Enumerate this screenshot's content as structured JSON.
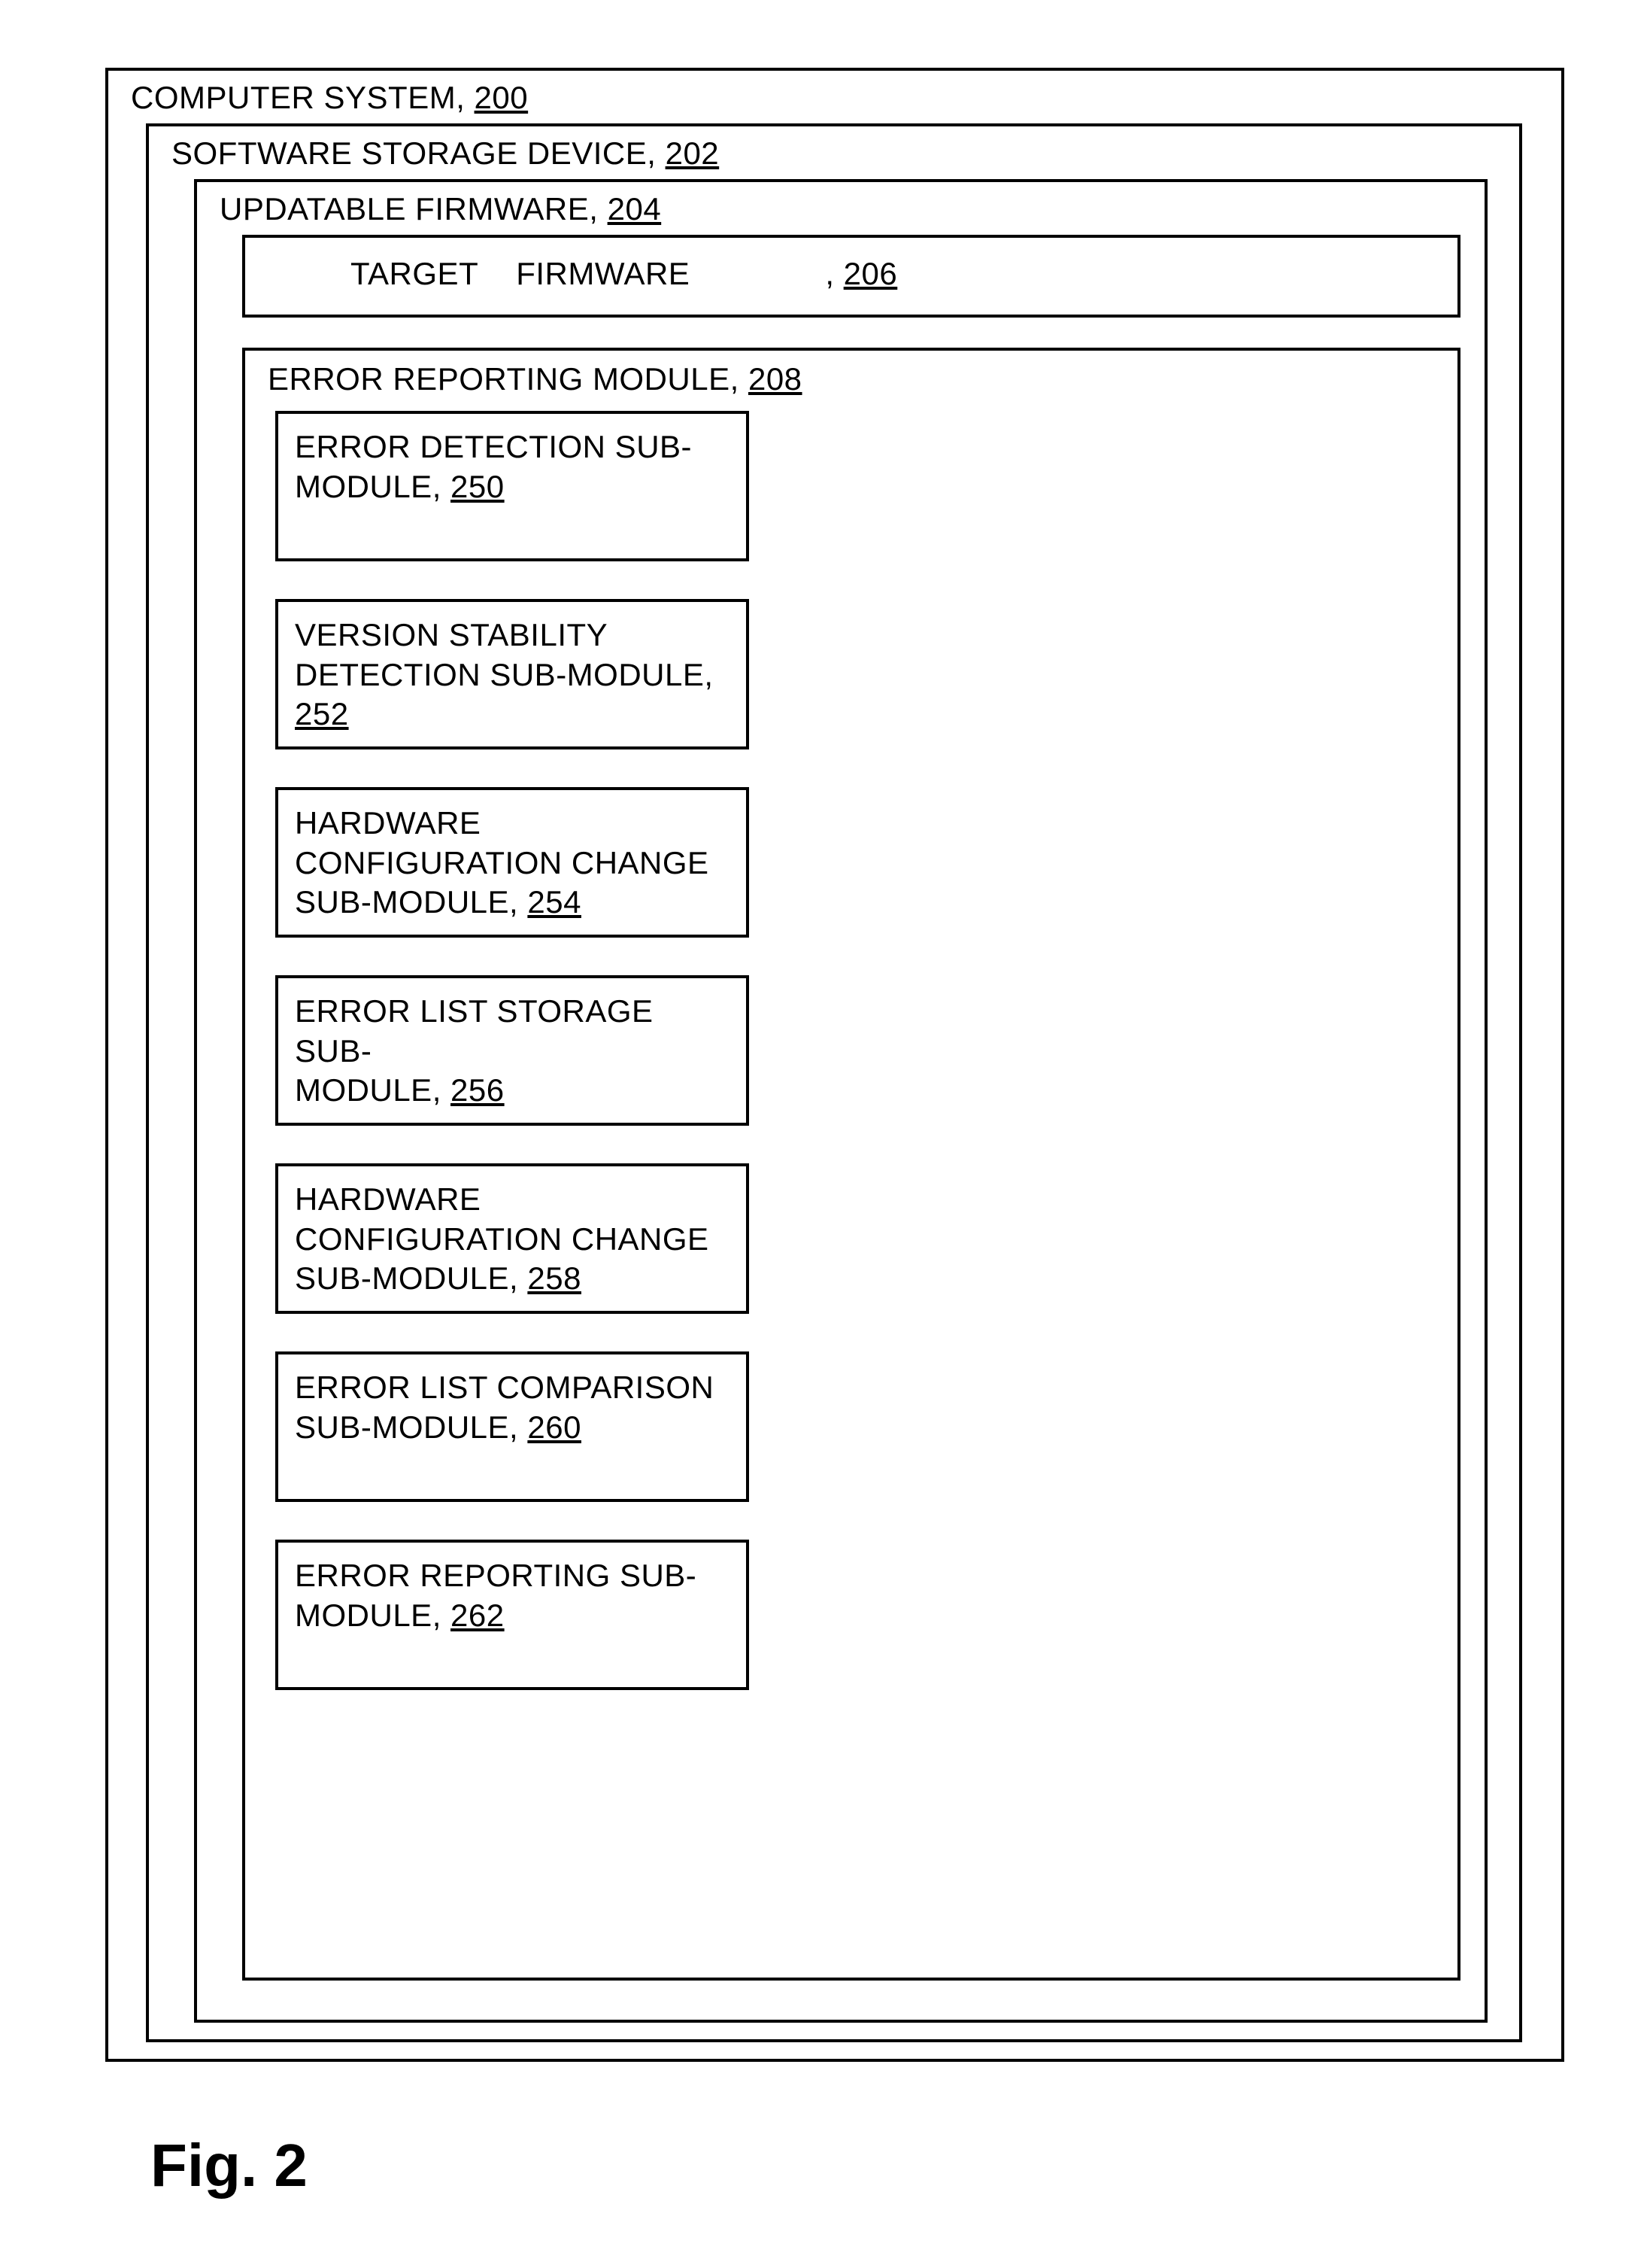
{
  "fig_caption": "Fig. 2",
  "outer": {
    "label": "COMPUTER SYSTEM, ",
    "ref": "200"
  },
  "l2": {
    "label": "SOFTWARE STORAGE DEVICE, ",
    "ref": "202"
  },
  "l3": {
    "label": "UPDATABLE FIRMWARE, ",
    "ref": "204"
  },
  "target": {
    "label_a": "TARGET",
    "label_b": "FIRMWARE",
    "comma": ", ",
    "ref": "206"
  },
  "errmod": {
    "label": "ERROR REPORTING MODULE, ",
    "ref": "208"
  },
  "subs": [
    {
      "line1": "ERROR DETECTION SUB-",
      "line2": "MODULE, ",
      "ref": "250",
      "line3": ""
    },
    {
      "line1": "VERSION STABILITY",
      "line2": "DETECTION SUB-MODULE,",
      "line3ref": "252"
    },
    {
      "line1": "HARDWARE",
      "line2": "CONFIGURATION CHANGE",
      "line3": "SUB-MODULE, ",
      "ref": "254"
    },
    {
      "line1": "ERROR LIST STORAGE SUB-",
      "line2": "MODULE, ",
      "ref": "256",
      "line3": ""
    },
    {
      "line1": "HARDWARE",
      "line2": "CONFIGURATION CHANGE",
      "line3": "SUB-MODULE, ",
      "ref": "258"
    },
    {
      "line1": "ERROR LIST COMPARISON",
      "line2": "SUB-MODULE, ",
      "ref": "260",
      "line3": ""
    },
    {
      "line1": "ERROR REPORTING SUB-",
      "line2": "MODULE, ",
      "ref": "262",
      "line3": ""
    }
  ]
}
